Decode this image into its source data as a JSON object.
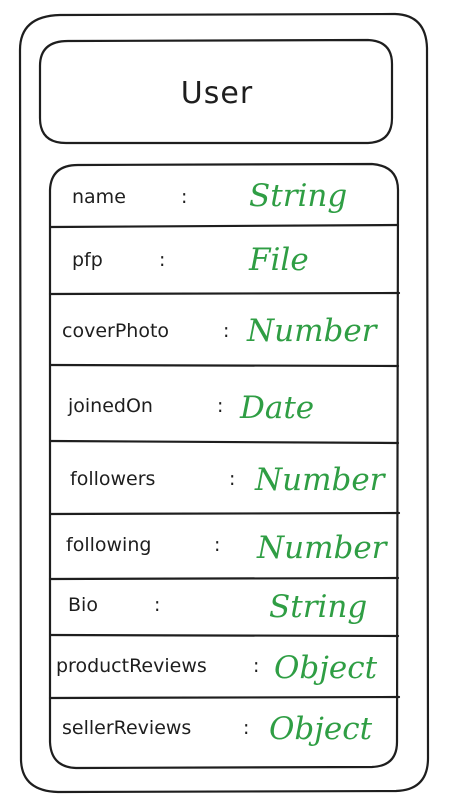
{
  "entity": {
    "title": "User"
  },
  "fields": [
    {
      "name": "name",
      "colon": ":",
      "type": "String"
    },
    {
      "name": "pfp",
      "colon": ":",
      "type": "File"
    },
    {
      "name": "coverPhoto",
      "colon": ":",
      "type": "Number"
    },
    {
      "name": "joinedOn",
      "colon": ":",
      "type": "Date"
    },
    {
      "name": "followers",
      "colon": ":",
      "type": "Number"
    },
    {
      "name": "following",
      "colon": ":",
      "type": "Number"
    },
    {
      "name": "Bio",
      "colon": ":",
      "type": "String"
    },
    {
      "name": "productReviews",
      "colon": ":",
      "type": "Object"
    },
    {
      "name": "sellerReviews",
      "colon": ":",
      "type": "Object"
    }
  ],
  "colors": {
    "stroke": "#1e1e1e",
    "type_text": "#2f9e44",
    "background": "#ffffff"
  }
}
